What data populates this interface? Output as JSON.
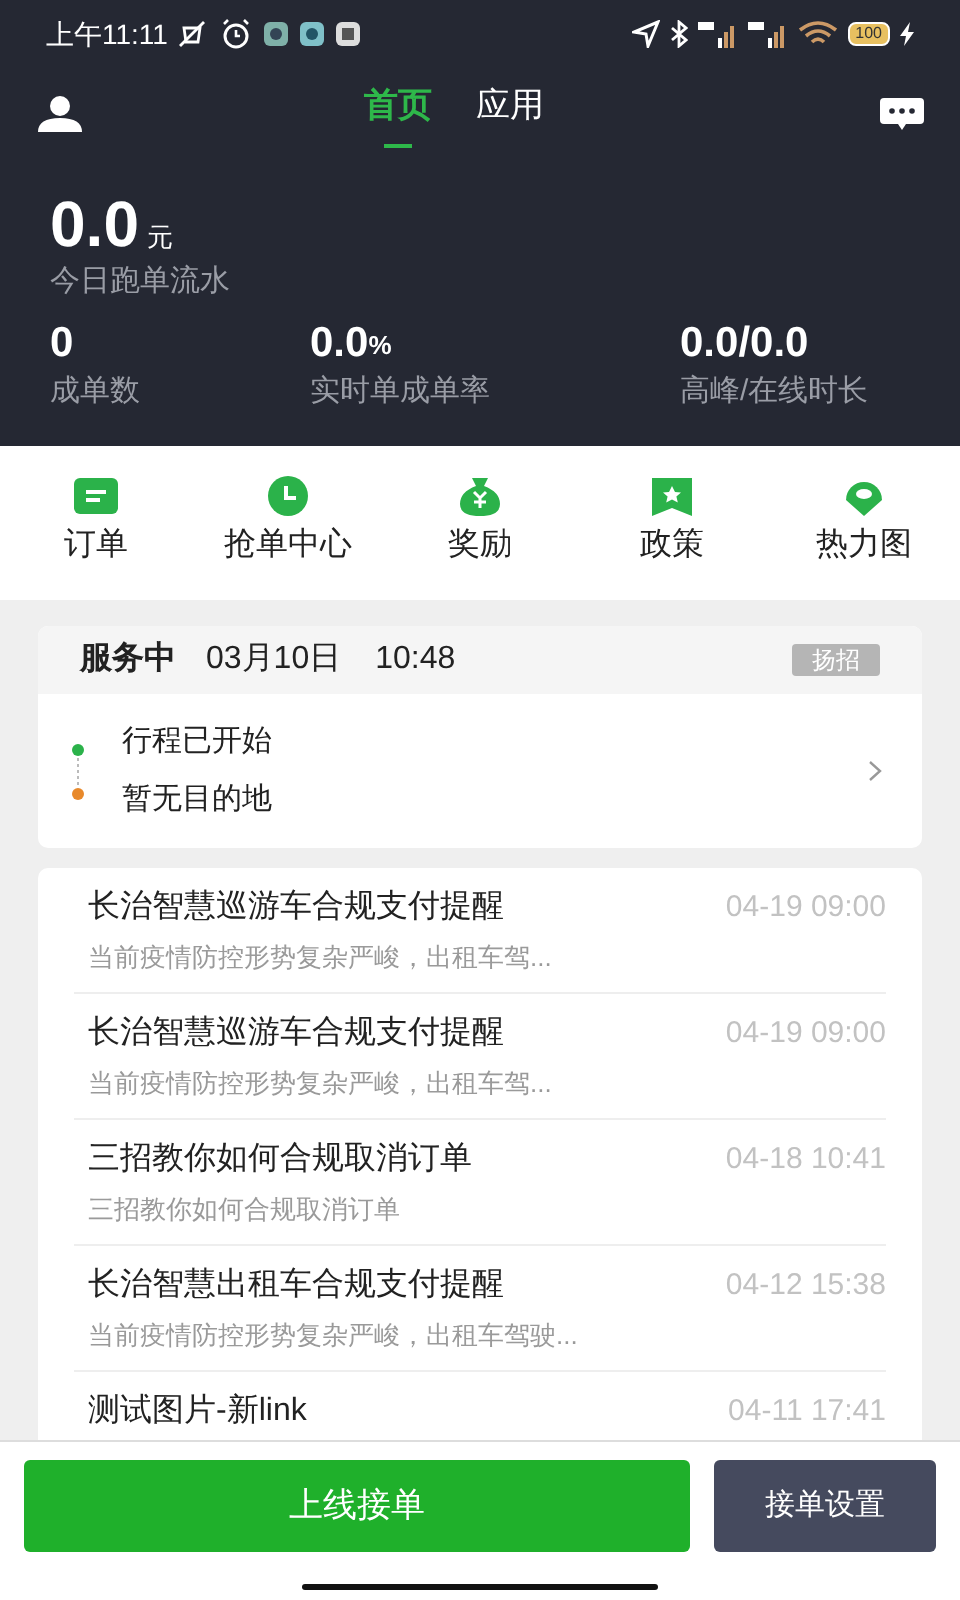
{
  "status_bar": {
    "time": "上午11:11",
    "battery": "100"
  },
  "tabs": [
    {
      "label": "首页",
      "selected": true
    },
    {
      "label": "应用",
      "selected": false
    }
  ],
  "earnings": {
    "value": "0.0",
    "unit": "元",
    "label": "今日跑单流水"
  },
  "stats": [
    {
      "value": "0",
      "label": "成单数"
    },
    {
      "value": "0.0",
      "unit": "%",
      "label": "实时单成单率"
    },
    {
      "value": "0.0/0.0",
      "label": "高峰/在线时长"
    }
  ],
  "shortcuts": [
    {
      "kind": "order",
      "label": "订单"
    },
    {
      "kind": "clock",
      "label": "抢单中心"
    },
    {
      "kind": "money",
      "label": "奖励"
    },
    {
      "kind": "star",
      "label": "政策"
    },
    {
      "kind": "pin",
      "label": "热力图"
    }
  ],
  "service": {
    "status": "服务中",
    "date": "03月10日",
    "time": "10:48",
    "tag": "扬招",
    "start": "行程已开始",
    "destination": "暂无目的地"
  },
  "news": [
    {
      "title": "长治智慧巡游车合规支付提醒",
      "time": "04-19 09:00",
      "summary": "当前疫情防控形势复杂严峻，出租车驾..."
    },
    {
      "title": "长治智慧巡游车合规支付提醒",
      "time": "04-19 09:00",
      "summary": "当前疫情防控形势复杂严峻，出租车驾..."
    },
    {
      "title": "三招教你如何合规取消订单",
      "time": "04-18 10:41",
      "summary": "三招教你如何合规取消订单"
    },
    {
      "title": "长治智慧出租车合规支付提醒",
      "time": "04-12 15:38",
      "summary": "当前疫情防控形势复杂严峻，出租车驾驶..."
    },
    {
      "title": "测试图片-新link",
      "time": "04-11 17:41"
    }
  ],
  "actions": {
    "primary": "上线接单",
    "secondary": "接单设置"
  }
}
